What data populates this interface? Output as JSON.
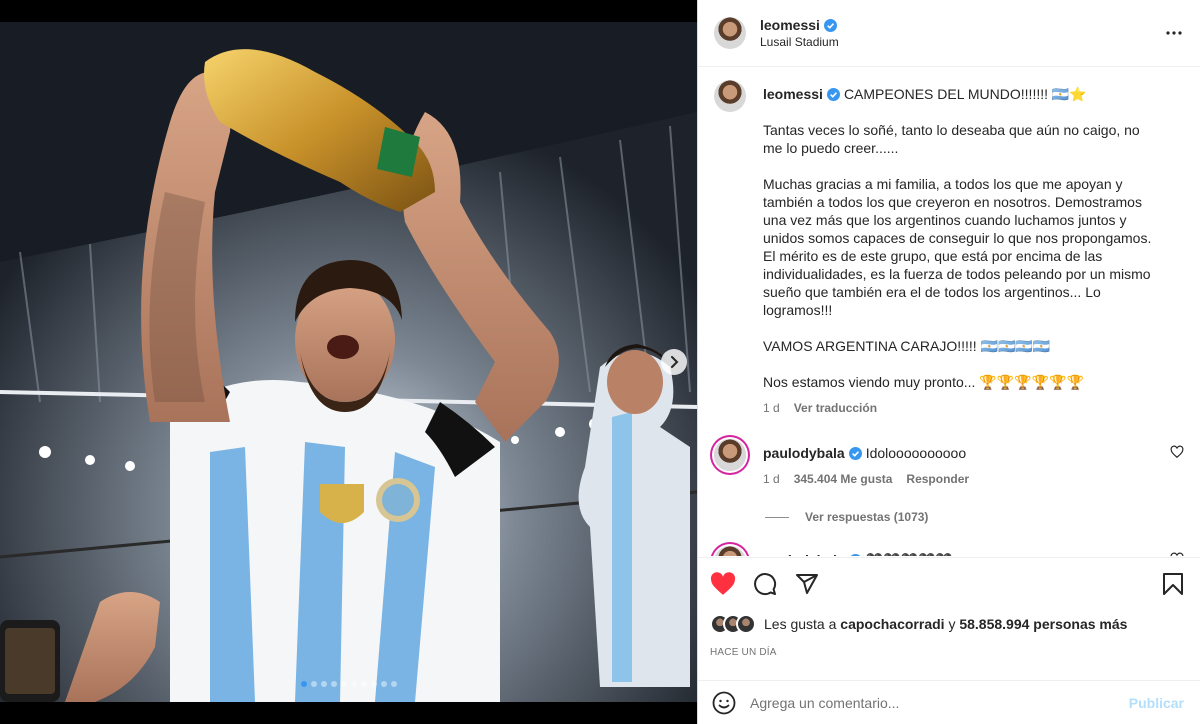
{
  "post": {
    "username": "leomessi",
    "location": "Lusail Stadium",
    "slide_count": 10,
    "active_slide": 0
  },
  "caption": {
    "username": "leomessi",
    "first_line": "CAMPEONES DEL MUNDO!!!!!!! 🇦🇷⭐",
    "paragraphs": [
      "Tantas veces lo soñé, tanto lo deseaba que aún no caigo, no me lo puedo creer......",
      "Muchas gracias a mi familia, a todos los que me apoyan y también a todos los que creyeron en nosotros. Demostramos una vez más que los argentinos cuando luchamos juntos y unidos somos capaces de conseguir lo que nos propongamos. El mérito es de este grupo, que está por encima de las individualidades, es la fuerza de todos peleando por un mismo sueño que también era el de todos los argentinos... Lo logramos!!!",
      "VAMOS ARGENTINA CARAJO!!!!! 🇦🇷🇦🇷🇦🇷🇦🇷",
      "Nos estamos viendo muy pronto... 🏆🏆🏆🏆🏆🏆"
    ],
    "time": "1 d",
    "translate": "Ver traducción"
  },
  "comments": [
    {
      "username": "paulodybala",
      "text": "Idoloooooooooo",
      "time": "1 d",
      "likes": "345.404 Me gusta",
      "reply": "Responder",
      "view_replies": "Ver respuestas (1073)"
    },
    {
      "username": "paulodybala",
      "text": "🖤🖤🖤🖤🖤"
    }
  ],
  "likes": {
    "prefix": "Les gusta a",
    "user": "capochacorradi",
    "connector": "y",
    "count": "58.858.994 personas más"
  },
  "time_ago": "HACE UN DÍA",
  "comment_box": {
    "placeholder": "Agrega un comentario...",
    "publish": "Publicar"
  },
  "colors": {
    "like_red": "#ff3040",
    "verified_blue": "#3797f0",
    "publish_disabled": "#b2dffc"
  },
  "icons": [
    "verified-badge-icon",
    "more-options-icon",
    "heart-icon",
    "comment-icon",
    "share-icon",
    "bookmark-icon",
    "emoji-icon",
    "chevron-right-icon"
  ]
}
